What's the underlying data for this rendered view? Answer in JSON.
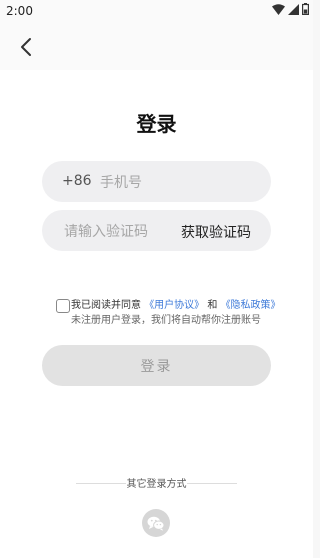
{
  "status_bar": {
    "time": "2:00",
    "icons": [
      "wifi-icon",
      "signal-icon",
      "battery-icon"
    ]
  },
  "nav": {
    "back_icon": "back-arrow-icon"
  },
  "page": {
    "title": "登录"
  },
  "phone": {
    "country_code": "+86",
    "placeholder": "手机号",
    "value": ""
  },
  "code": {
    "placeholder": "请输入验证码",
    "value": "",
    "get_code_label": "获取验证码"
  },
  "agreement": {
    "checked": false,
    "prefix": "我已阅读并同意",
    "user_agreement": "《用户协议》",
    "and": "和",
    "privacy_policy": "《隐私政策》",
    "note": "未注册用户登录，我们将自动帮你注册账号"
  },
  "login_button": {
    "label": "登录"
  },
  "other_login": {
    "label": "其它登录方式",
    "methods": [
      "wechat-icon"
    ]
  },
  "colors": {
    "link": "#3f7bd9",
    "field_bg": "#efeff1",
    "button_bg": "#e2e2e2"
  }
}
